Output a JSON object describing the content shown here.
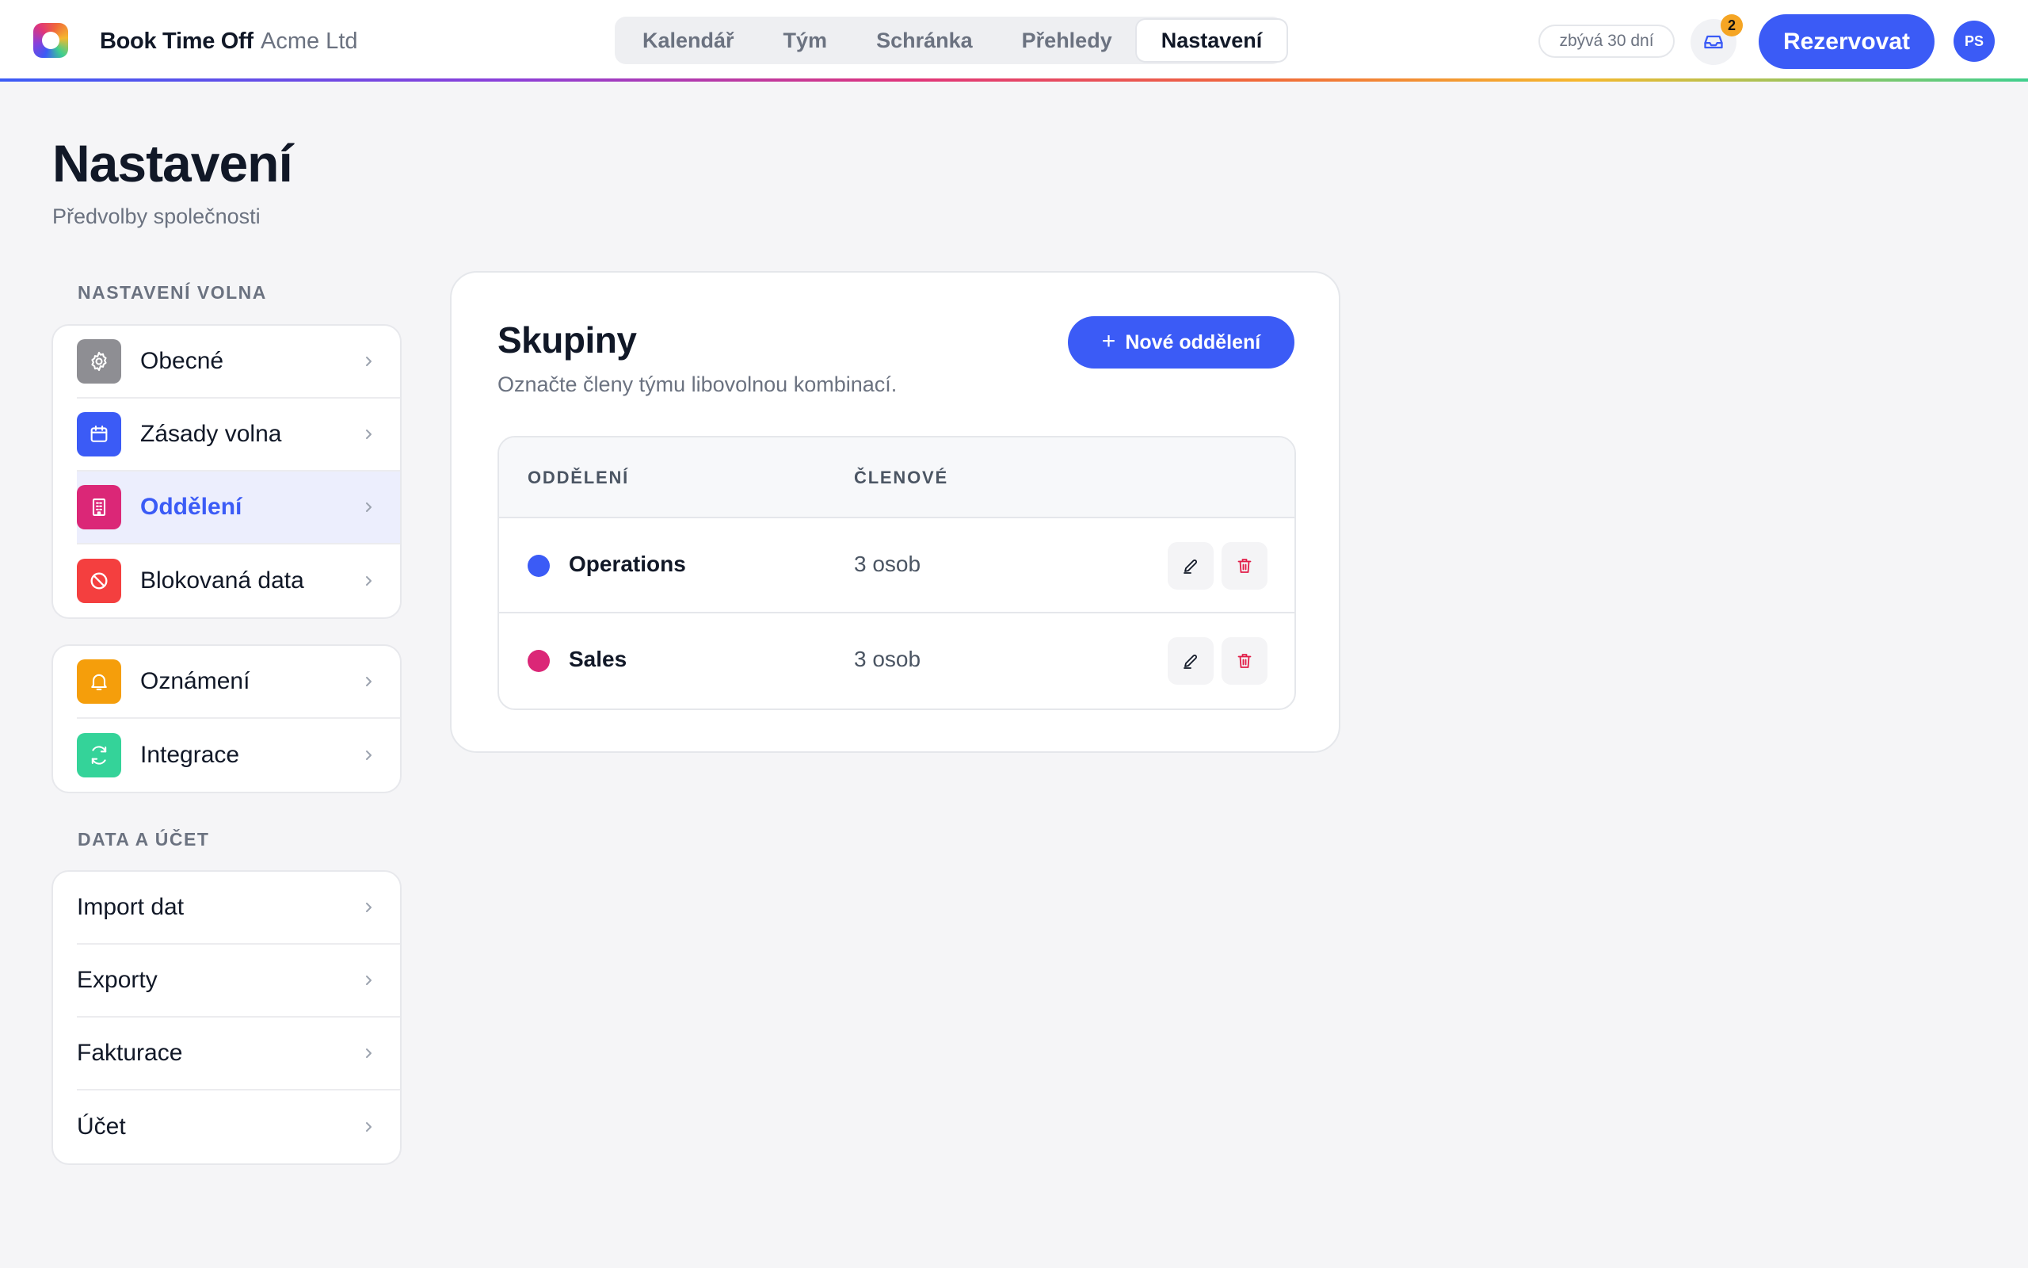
{
  "app": {
    "brand": "Book Time Off",
    "company": "Acme Ltd",
    "trial": "zbývá 30 dní",
    "inbox_count": "2",
    "book_label": "Rezervovat",
    "avatar_initials": "PS"
  },
  "nav": {
    "tabs": [
      {
        "label": "Kalendář"
      },
      {
        "label": "Tým"
      },
      {
        "label": "Schránka"
      },
      {
        "label": "Přehledy"
      },
      {
        "label": "Nastavení",
        "active": true
      }
    ]
  },
  "page": {
    "title": "Nastavení",
    "subtitle": "Předvolby společnosti"
  },
  "sidebar": {
    "section1_label": "NASTAVENÍ VOLNA",
    "group1": [
      {
        "label": "Obecné",
        "icon": "gear-icon",
        "color": "#8e8e93"
      },
      {
        "label": "Zásady volna",
        "icon": "calendar-icon",
        "color": "#3b5bf6"
      },
      {
        "label": "Oddělení",
        "icon": "building-icon",
        "color": "#db2777",
        "active": true
      },
      {
        "label": "Blokovaná data",
        "icon": "block-icon",
        "color": "#f43f3f"
      }
    ],
    "group2": [
      {
        "label": "Oznámení",
        "icon": "bell-icon",
        "color": "#f59e0b"
      },
      {
        "label": "Integrace",
        "icon": "sync-icon",
        "color": "#34d399"
      }
    ],
    "section2_label": "DATA A ÚČET",
    "group3": [
      {
        "label": "Import dat"
      },
      {
        "label": "Exporty"
      },
      {
        "label": "Fakturace"
      },
      {
        "label": "Účet"
      }
    ]
  },
  "main": {
    "title": "Skupiny",
    "subtitle": "Označte členy týmu libovolnou kombinací.",
    "new_button": "Nové oddělení",
    "columns": [
      "ODDĚLENÍ",
      "ČLENOVÉ"
    ],
    "rows": [
      {
        "name": "Operations",
        "members": "3 osob",
        "color": "#3b5bf6"
      },
      {
        "name": "Sales",
        "members": "3 osob",
        "color": "#db2777"
      }
    ]
  },
  "colors": {
    "accent": "#3b5bf6",
    "delete": "#e11d48"
  }
}
